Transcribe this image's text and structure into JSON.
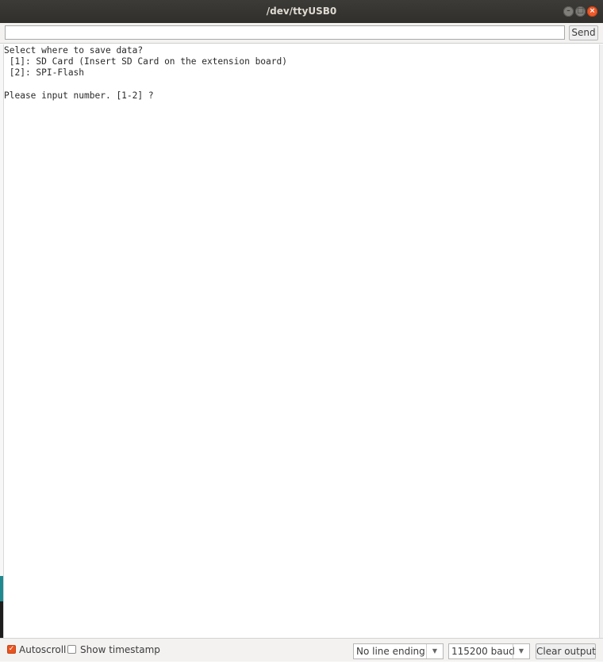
{
  "window": {
    "title": "/dev/ttyUSB0"
  },
  "input": {
    "value": "",
    "placeholder": ""
  },
  "send_label": "Send",
  "output_lines": [
    "Select where to save data?",
    " [1]: SD Card (Insert SD Card on the extension board)",
    " [2]: SPI-Flash",
    "",
    "Please input number. [1-2] ?"
  ],
  "footer": {
    "autoscroll_label": "Autoscroll",
    "autoscroll_checked": true,
    "timestamp_label": "Show timestamp",
    "timestamp_checked": false,
    "line_ending": "No line ending",
    "baud": "115200 baud",
    "clear_label": "Clear output"
  },
  "icons": {
    "minimize": "minimize-icon",
    "maximize": "maximize-icon",
    "close": "close-icon",
    "dropdown": "chevron-down-icon",
    "check": "check-icon"
  },
  "colors": {
    "accent": "#e95420",
    "titlebar": "#3c3b37"
  }
}
